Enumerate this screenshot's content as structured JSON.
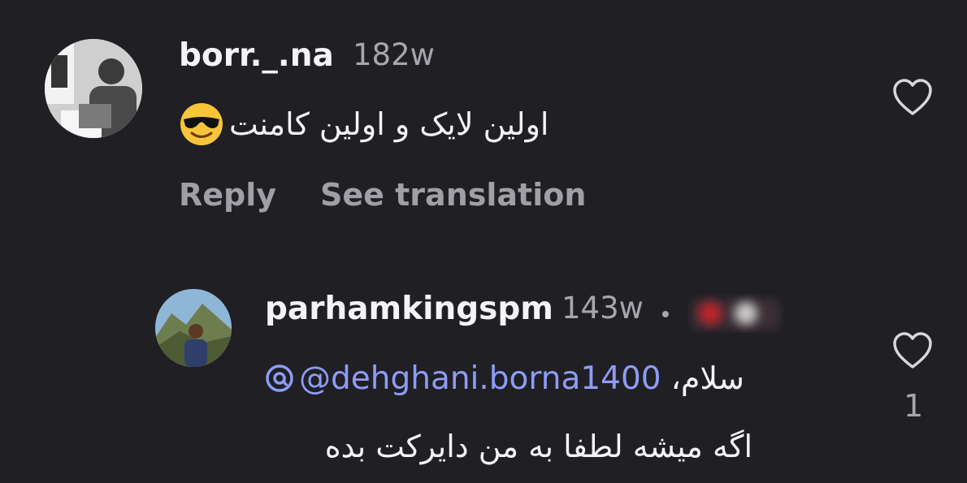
{
  "comments": [
    {
      "username": "borr._.na",
      "time": "182w",
      "text": "اولین لایک و اولین کامنت",
      "emoji": "smiling-face-with-sunglasses",
      "actions": {
        "reply": "Reply",
        "see_translation": "See translation"
      }
    }
  ],
  "reply": {
    "username": "parhamkingspm",
    "time": "143w",
    "greeting": "سلام،",
    "mention": "@dehghani.borna1400",
    "text_line2": "اگه میشه لطفا به من دایرکت بده",
    "like_count": "1"
  },
  "colors": {
    "background": "#1f1f24",
    "mention": "#8f9cf5",
    "secondary_text": "#a6a7ad"
  }
}
